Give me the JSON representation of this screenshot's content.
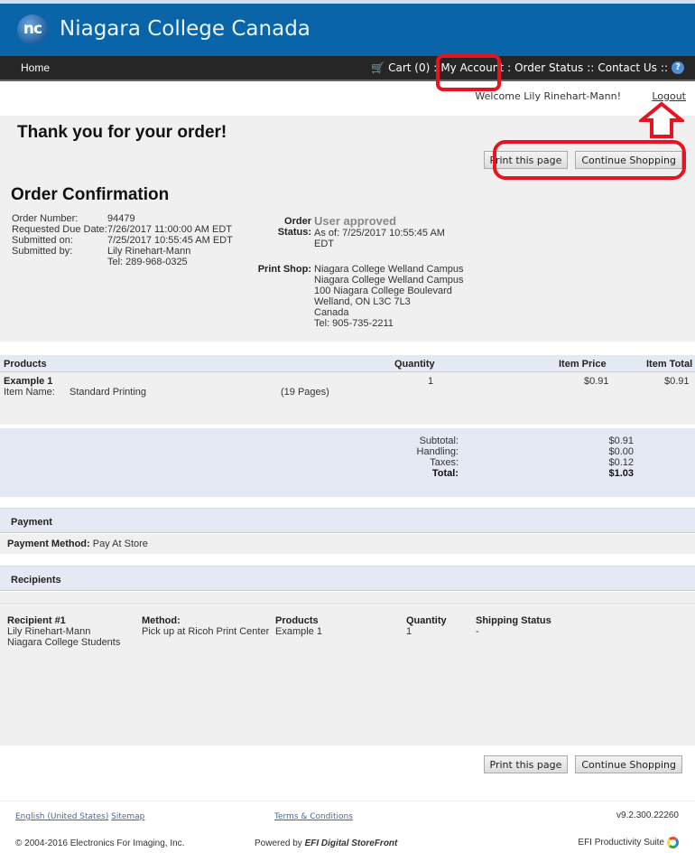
{
  "header": {
    "logo_initials": "nc",
    "brand_name": "Niagara College Canada",
    "nav": {
      "home": "Home",
      "cart": "Cart (0)",
      "my_account": "My Account",
      "order_status": "Order Status",
      "contact_us": "Contact Us",
      "sep1": ":",
      "sep2": ":",
      "sep3": "::",
      "sep4": "::",
      "help": "?"
    },
    "welcome": "Welcome Lily Rinehart-Mann!",
    "logout": "Logout"
  },
  "page": {
    "thanks_title": "Thank you for your order!",
    "print_button": "Print this page",
    "continue_button": "Continue Shopping",
    "confirmation_title": "Order Confirmation"
  },
  "order": {
    "number_label": "Order Number:",
    "number": "94479",
    "due_label": "Requested Due Date:",
    "due": "7/26/2017 11:00:00 AM EDT",
    "submitted_on_label": "Submitted on:",
    "submitted_on": "7/25/2017 10:55:45 AM EDT",
    "submitted_by_label": "Submitted by:",
    "submitted_by": "Lily Rinehart-Mann",
    "submitted_by_tel": "Tel: 289-968-0325",
    "status_label": "Order Status:",
    "status": "User approved",
    "status_as_of_1": "As of: 7/25/2017 10:55:45 AM",
    "status_as_of_2": "EDT",
    "print_shop_label": "Print Shop:",
    "print_shop_lines": [
      "Niagara College Welland Campus",
      "Niagara College Welland Campus",
      "100 Niagara College Boulevard",
      "Welland, ON L3C 7L3",
      "Canada",
      "Tel: 905-735-2211"
    ]
  },
  "products": {
    "headers": {
      "products": "Products",
      "quantity": "Quantity",
      "item_price": "Item Price",
      "item_total": "Item Total"
    },
    "items": [
      {
        "name": "Example 1",
        "item_name_label": "Item Name:",
        "item_name": "Standard Printing",
        "pages": "(19  Pages)",
        "quantity": "1",
        "price": "$0.91",
        "total": "$0.91"
      }
    ],
    "totals": {
      "subtotal_label": "Subtotal:",
      "subtotal": "$0.91",
      "handling_label": "Handling:",
      "handling": "$0.00",
      "taxes_label": "Taxes:",
      "taxes": "$0.12",
      "total_label": "Total:",
      "total": "$1.03"
    }
  },
  "payment": {
    "title": "Payment",
    "method_label": "Payment Method:",
    "method": "Pay At Store"
  },
  "recipients": {
    "title": "Recipients",
    "items": [
      {
        "label": "Recipient #1",
        "name": "Lily Rinehart-Mann",
        "group": "Niagara College Students",
        "method_label": "Method:",
        "method": "Pick up at Ricoh Print Center",
        "products_label": "Products",
        "products": "Example 1",
        "quantity_label": "Quantity",
        "quantity": "1",
        "shipping_label": "Shipping Status",
        "shipping": "-"
      }
    ]
  },
  "footer": {
    "language": "English (United States)",
    "sitemap": "Sitemap",
    "terms": "Terms & Conditions",
    "version": "v9.2.300.22260",
    "copyright": "© 2004-2016 Electronics For Imaging, Inc.",
    "powered_by": "Powered by",
    "powered_product": "EFI Digital StoreFront",
    "suite": "EFI Productivity Suite"
  },
  "annotations": {
    "highlight_color": "#e8131e"
  }
}
